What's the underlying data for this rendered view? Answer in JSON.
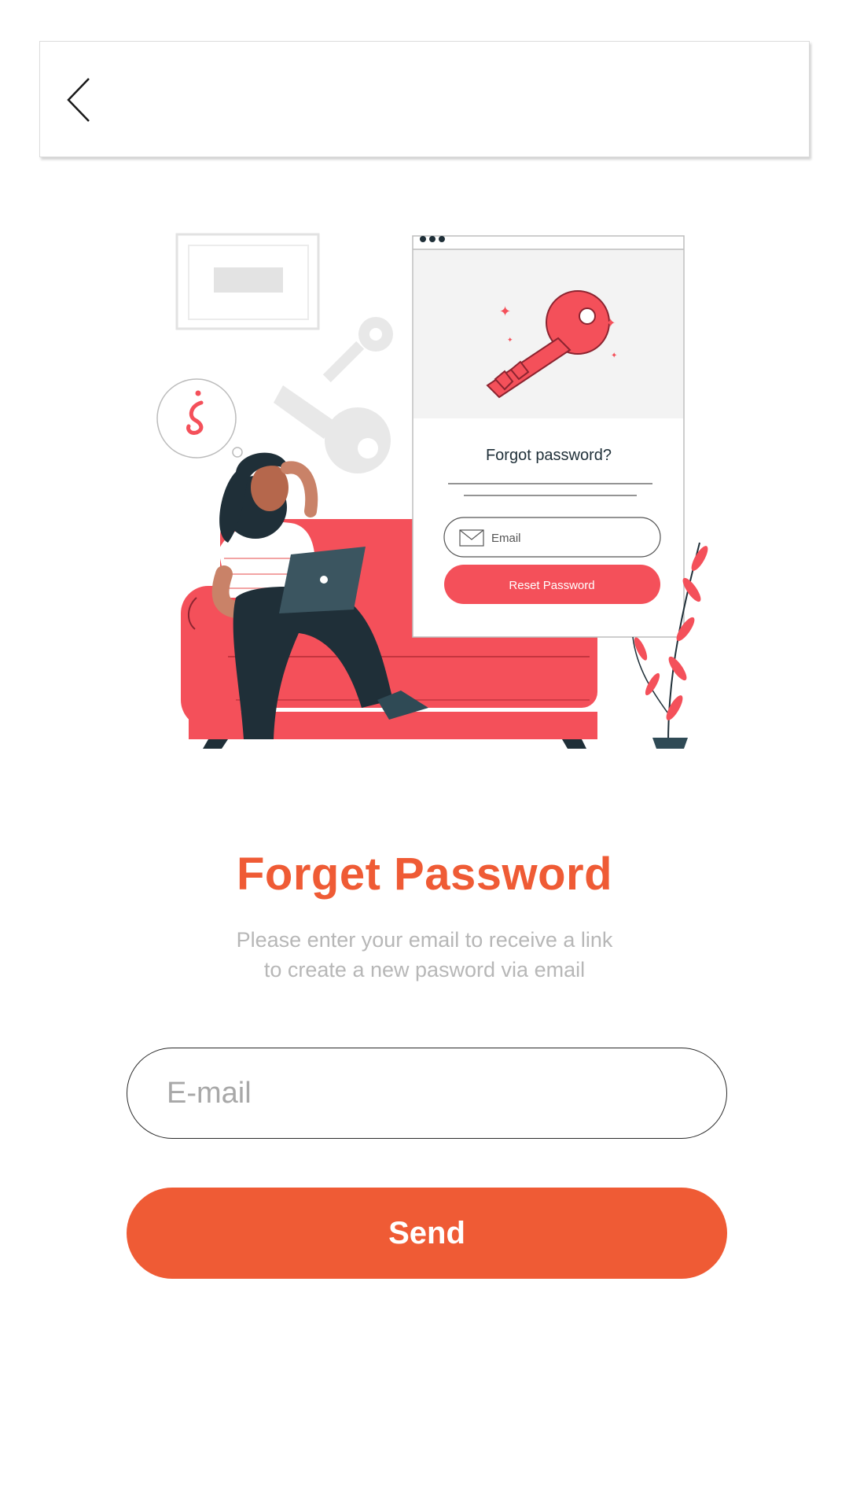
{
  "header": {
    "back_icon": "chevron-left-icon"
  },
  "illustration": {
    "card_title": "Forgot password?",
    "card_email_placeholder": "Email",
    "card_button_label": "Reset Password"
  },
  "main": {
    "title": "Forget Password",
    "subtitle_line1": "Please enter your email to receive a link",
    "subtitle_line2": "to create a new pasword via email",
    "email_placeholder": "E-mail",
    "send_label": "Send"
  },
  "colors": {
    "accent": "#ef5b35",
    "illustration_red": "#f4505a",
    "dark": "#1f2f38"
  }
}
